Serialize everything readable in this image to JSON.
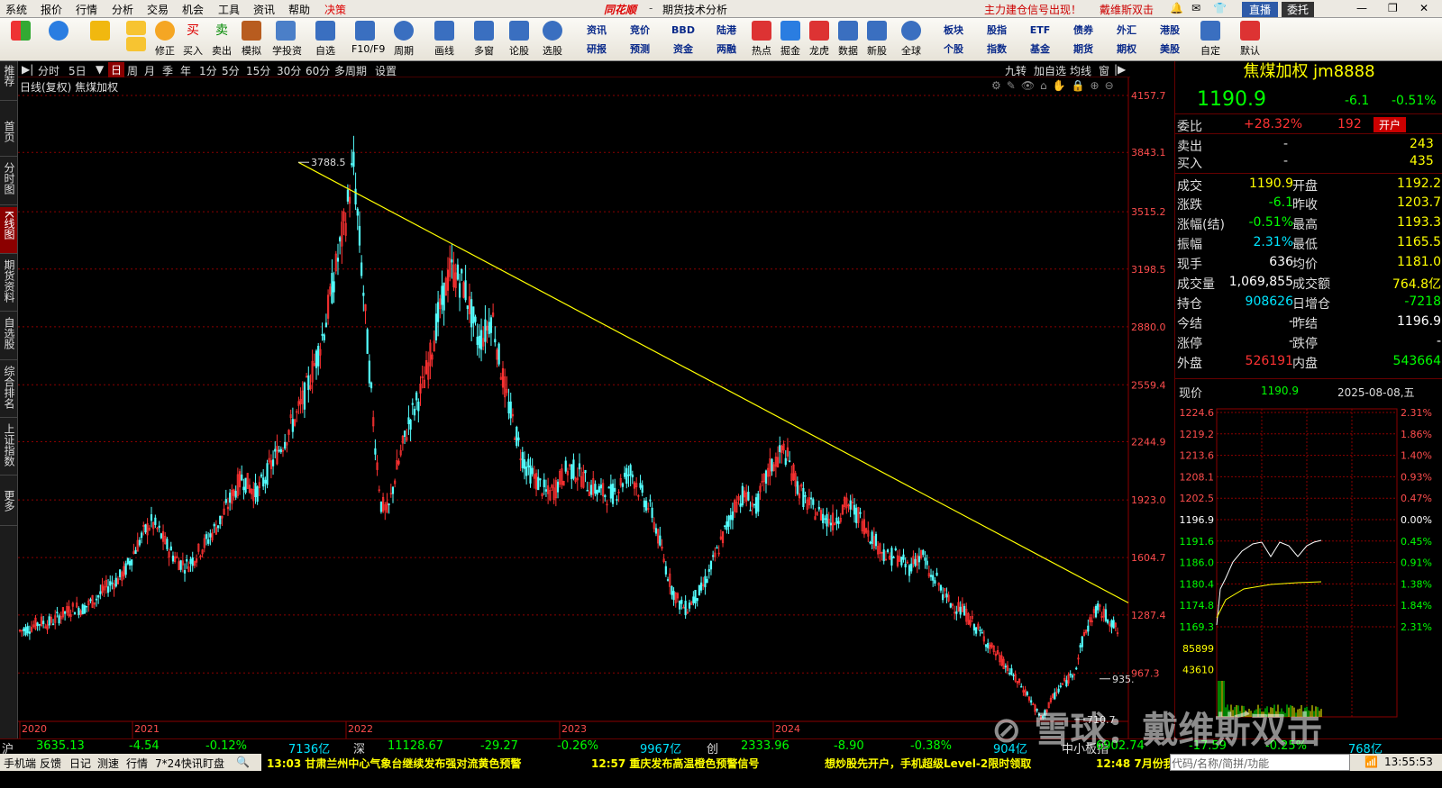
{
  "menu": [
    "系统",
    "报价",
    "行情",
    "分析",
    "交易",
    "机会",
    "工具",
    "资讯",
    "帮助",
    "决策"
  ],
  "app_logo": "同花顺",
  "window_title": "期货技术分析",
  "promo_top": "主力建仓信号出现！",
  "user": "戴维斯双击",
  "live_btn": "直播",
  "entrust_btn": "委托",
  "toolbar_left": [
    {
      "icon": "windows-icon",
      "label": ""
    },
    {
      "icon": "robot-icon",
      "label": ""
    },
    {
      "icon": "back-arrow-icon",
      "label": ""
    },
    {
      "icon": "up-down-arrows-icon",
      "label": ""
    },
    {
      "icon": "correct-icon",
      "label": "修正"
    },
    {
      "icon": "buy-icon",
      "label": "买入"
    },
    {
      "icon": "sell-icon",
      "label": "卖出"
    },
    {
      "icon": "hammer-icon",
      "label": "模拟"
    },
    {
      "icon": "graduation-cap-icon",
      "label": "学投资"
    },
    {
      "icon": "star-icon",
      "label": "自选"
    },
    {
      "icon": "f10-icon",
      "label": "F10/F9"
    },
    {
      "icon": "clock-icon",
      "label": "周期"
    },
    {
      "icon": "pencil-icon",
      "label": "画线"
    },
    {
      "icon": "multi-chart-icon",
      "label": "多窗"
    },
    {
      "icon": "discuss-icon",
      "label": "论股"
    },
    {
      "icon": "search-icon",
      "label": "选股"
    }
  ],
  "toolbar_grid_top": [
    "资讯",
    "竞价",
    "BBD",
    "陆港"
  ],
  "toolbar_grid_bottom": [
    "研报",
    "预测",
    "资金",
    "两融"
  ],
  "toolbar_mid": [
    {
      "icon": "hot-icon",
      "label": "热点"
    },
    {
      "icon": "dig-icon",
      "label": "掘金"
    },
    {
      "icon": "dragon-icon",
      "label": "龙虎"
    },
    {
      "icon": "pe-icon",
      "label": "数据"
    },
    {
      "icon": "ipo-icon",
      "label": "新股"
    },
    {
      "icon": "globe-icon",
      "label": "全球"
    }
  ],
  "toolbar_grid2_top": [
    "板块",
    "股指",
    "ETF",
    "债券",
    "外汇",
    "港股"
  ],
  "toolbar_grid2_bottom": [
    "个股",
    "指数",
    "基金",
    "期货",
    "期权",
    "美股"
  ],
  "toolbar_right": [
    {
      "icon": "custom-icon",
      "label": "自定"
    },
    {
      "icon": "home-icon",
      "label": "默认"
    }
  ],
  "periods": [
    "分时",
    "5日",
    "日",
    "周",
    "月",
    "季",
    "年",
    "1分",
    "5分",
    "15分",
    "30分",
    "60分",
    "多周期",
    "设置"
  ],
  "period_active": "日",
  "period_right": [
    "九转",
    "加自选",
    "均线",
    "窗"
  ],
  "side_nav": [
    "推荐",
    "首页",
    "分时图",
    "K线图",
    "期货资料",
    "自选股",
    "综合排名",
    "上证指数",
    "更多"
  ],
  "side_nav_active": "K线图",
  "chart_caption": "日线(复权)  焦煤加权",
  "chart_data": {
    "type": "candlestick",
    "title": "日线(复权)  焦煤加权",
    "xlabel": "",
    "ylabel": "",
    "yticks": [
      4157.7,
      3843.1,
      3515.2,
      3198.5,
      2880.0,
      2559.4,
      2244.9,
      1923.0,
      1604.7,
      1287.4,
      967.3
    ],
    "years": [
      "2020",
      "2021",
      "2022",
      "2023",
      "2024"
    ],
    "annotations": [
      {
        "text": "3788.5"
      },
      {
        "text": "710.7"
      },
      {
        "text": "935."
      }
    ],
    "trendline": {
      "from": [
        2021.75,
        3788.5
      ],
      "to": [
        2025.6,
        1355
      ]
    },
    "series": [
      {
        "values": [
          1200,
          1210,
          1230,
          1250,
          1240,
          1260,
          1290,
          1310,
          1330,
          1320,
          1350,
          1380,
          1420,
          1460,
          1480,
          1520,
          1600,
          1680,
          1750,
          1800,
          1750,
          1680,
          1620,
          1580,
          1560,
          1600,
          1650,
          1700,
          1760,
          1820,
          1900,
          1980,
          2050,
          2000,
          1960,
          2020,
          2100,
          2180,
          2250,
          2330,
          2400,
          2500,
          2620,
          2750,
          2900,
          3100,
          3300,
          3500,
          3788.5,
          3300,
          2800,
          2300,
          1900,
          1850,
          2050,
          2200,
          2350,
          2450,
          2550,
          2700,
          2900,
          3050,
          3200,
          3150,
          3100,
          2950,
          2800,
          2850,
          2950,
          2700,
          2500,
          2350,
          2200,
          2100,
          2050,
          2000,
          1950,
          1980,
          2050,
          2100,
          2080,
          2050,
          2000,
          1980,
          1960,
          1950,
          1980,
          2050,
          2080,
          1990,
          1920,
          1850,
          1700,
          1550,
          1420,
          1350,
          1320,
          1380,
          1420,
          1500,
          1600,
          1700,
          1800,
          1900,
          1950,
          1920,
          1880,
          2000,
          2100,
          2150,
          2200,
          2100,
          2000,
          1920,
          1880,
          1850,
          1830,
          1800,
          1850,
          1900,
          1870,
          1820,
          1760,
          1700,
          1650,
          1600,
          1620,
          1580,
          1550,
          1600,
          1620,
          1500,
          1480,
          1400,
          1350,
          1330,
          1300,
          1250,
          1200,
          1150,
          1100,
          1050,
          1000,
          950,
          900,
          850,
          780,
          710.7,
          780,
          850,
          900,
          935,
          1000,
          1150,
          1250,
          1320,
          1290,
          1260,
          1190.9
        ]
      }
    ]
  },
  "quote": {
    "name": "焦煤加权 jm8888",
    "price": "1190.9",
    "change": "-6.1",
    "pct": "-0.51%",
    "wbi_label": "委比",
    "wbi": "+28.32%",
    "wbi_vol": "192",
    "open_acct": "开户",
    "sell_label": "卖出",
    "sell_val": "-",
    "sell_vol": "243",
    "buy_label": "买入",
    "buy_val": "-",
    "buy_vol": "435",
    "rows": [
      [
        "成交",
        "1190.9",
        "开盘",
        "1192.2"
      ],
      [
        "涨跌",
        "-6.1",
        "昨收",
        "1203.7"
      ],
      [
        "涨幅(结)",
        "-0.51%",
        "最高",
        "1193.3"
      ],
      [
        "振幅",
        "2.31%",
        "最低",
        "1165.5"
      ],
      [
        "现手",
        "636",
        "均价",
        "1181.0"
      ],
      [
        "成交量",
        "1,069,855",
        "成交额",
        "764.8亿"
      ],
      [
        "持仓",
        "908626",
        "日增仓",
        "-7218"
      ],
      [
        "今结",
        "-",
        "昨结",
        "1196.9"
      ],
      [
        "涨停",
        "-",
        "跌停",
        "-"
      ],
      [
        "外盘",
        "526191",
        "内盘",
        "543664"
      ]
    ],
    "intraday_label": "现价",
    "intraday_price": "1190.9",
    "intraday_date": "2025-08-08,五",
    "intraday_left": [
      "1224.6",
      "1219.2",
      "1213.6",
      "1208.1",
      "1202.5",
      "1196.9",
      "1191.6",
      "1186.0",
      "1180.4",
      "1174.8",
      "1169.3",
      "85899",
      "43610"
    ],
    "intraday_right": [
      "2.31%",
      "1.86%",
      "1.40%",
      "0.93%",
      "0.47%",
      "0.00%",
      "0.45%",
      "0.91%",
      "1.38%",
      "1.84%",
      "2.31%"
    ]
  },
  "index_bar": [
    {
      "name": "沪",
      "val": "3635.13",
      "chg": "-4.54",
      "pct": "-0.12%",
      "amt": "7136亿"
    },
    {
      "name": "深",
      "val": "11128.67",
      "chg": "-29.27",
      "pct": "-0.26%",
      "amt": "9967亿"
    },
    {
      "name": "创",
      "val": "2333.96",
      "chg": "-8.90",
      "pct": "-0.38%",
      "amt": "904亿"
    },
    {
      "name": "中小板指",
      "val": "6902.74",
      "chg": "-17.59",
      "pct": "-0.25%",
      "amt": "768亿"
    }
  ],
  "status_bar": {
    "tabs": [
      "手机端",
      "反馈",
      "日记",
      "测速",
      "行情",
      "7*24快讯",
      "盯盘"
    ],
    "news1": "13:03 甘肃兰州中心气象台继续发布强对流黄色预警",
    "news2": "12:57 重庆发布高温橙色预警信号",
    "news3": "想炒股先开户，手机超级Level-2限时领取",
    "news4": "12:48 7月份我",
    "search_placeholder": "代码/名称/简拼/功能",
    "time": "13:55:53"
  },
  "watermark": "雪球：戴维斯双击",
  "colors": {
    "up": "#ff3232",
    "down": "#54ffff",
    "trend": "#ffff00",
    "grid": "#8b0000",
    "text_yellow": "#ffff00",
    "text_green": "#00ff00",
    "text_cyan": "#00e5ff"
  }
}
